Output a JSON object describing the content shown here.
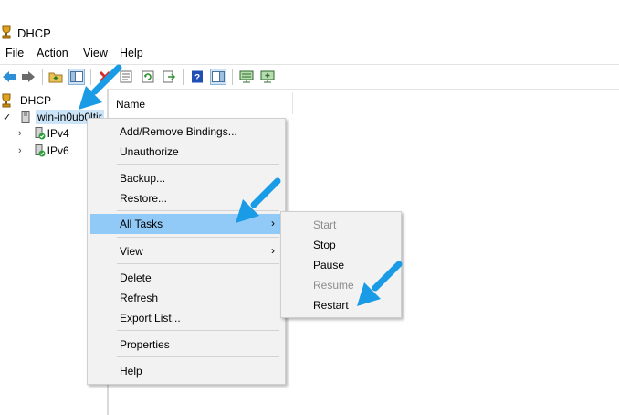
{
  "window": {
    "title": "DHCP"
  },
  "menubar": [
    "File",
    "Action",
    "View",
    "Help"
  ],
  "toolbar": {
    "icons": [
      "back-arrow-icon",
      "forward-arrow-icon",
      "up-folder-icon",
      "show-hide-console-tree-icon",
      "delete-icon",
      "properties-icon",
      "refresh-icon",
      "export-list-icon",
      "help-icon",
      "show-hide-action-pane-icon",
      "server-icon",
      "add-server-icon"
    ]
  },
  "tree": {
    "root": "DHCP",
    "server": "win-in0ub0ltir",
    "children": [
      "IPv4",
      "IPv6"
    ]
  },
  "list": {
    "column_header": "Name"
  },
  "context_menu": {
    "items": [
      "Add/Remove Bindings...",
      "Unauthorize",
      "Backup...",
      "Restore...",
      "All Tasks",
      "View",
      "Delete",
      "Refresh",
      "Export List...",
      "Properties",
      "Help"
    ],
    "highlighted": "All Tasks",
    "submenu_arrow": "›"
  },
  "submenu": {
    "items": [
      "Start",
      "Stop",
      "Pause",
      "Resume",
      "Restart"
    ],
    "disabled": [
      "Start",
      "Resume"
    ]
  },
  "colors": {
    "highlight": "#91c9f7",
    "callout_arrow": "#1a9be6",
    "menu_bg": "#f2f2f2"
  }
}
